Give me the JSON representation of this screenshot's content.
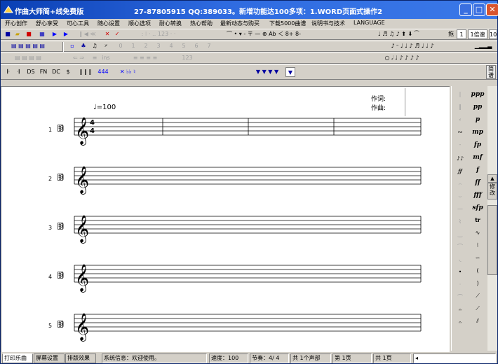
{
  "window": {
    "title": "作曲大师简+线免费版",
    "title_extra": "27-87805915 QQ:389033。新增功能达100多项：1.WORD页面式操作2",
    "minimize": "_",
    "maximize": "□",
    "close": "✕"
  },
  "menu": [
    "开心创作",
    "舒心享受",
    "可心工具",
    "随心设置",
    "顺心选项",
    "耐心转换",
    "热心帮助",
    "最新动态与购买",
    "下载5000曲谱",
    "说明书与技术",
    "LANGUAGE"
  ],
  "toolbar1": {
    "zoom_label": "拖",
    "page_box": "1",
    "zoom_box": "1倍速",
    "zoom_num": "10"
  },
  "toolbar2": {
    "numbers": [
      "0",
      "1",
      "2",
      "3",
      "4",
      "5",
      "6",
      "7"
    ]
  },
  "toolbar3": {
    "ins": "ins",
    "numbers_dim": "123"
  },
  "toolbar4": {
    "labels": [
      "DS",
      "FN",
      "DC",
      "$",
      "444"
    ]
  },
  "side_label": "简谱",
  "side_label2": "修改",
  "score": {
    "tempo": "=100",
    "lyricist_label": "作词:",
    "composer_label": "作曲:",
    "time_sig_top": "4",
    "time_sig_bottom": "4",
    "staff_numbers": [
      "1",
      "2",
      "3",
      "4",
      "5"
    ],
    "instrument_icon": "钢"
  },
  "palette_dynamics": [
    "ppp",
    "pp",
    "p",
    "mp",
    "fp",
    "mf",
    "f",
    "ff",
    "fff",
    "sfp",
    "tr"
  ],
  "statusbar": {
    "tabs": [
      "打印乐曲",
      "屏幕设置",
      "排版效果"
    ],
    "info": "系统信息：欢迎使用。",
    "speed": "速度：100",
    "meter": "节奏：4/ 4",
    "voices": "共 1个声部",
    "page": "第 1页",
    "total": "共 1页"
  },
  "colors": {
    "titlebar": "#2f6be0",
    "accent_blue": "#0000ff",
    "accent_red": "#d00000"
  }
}
